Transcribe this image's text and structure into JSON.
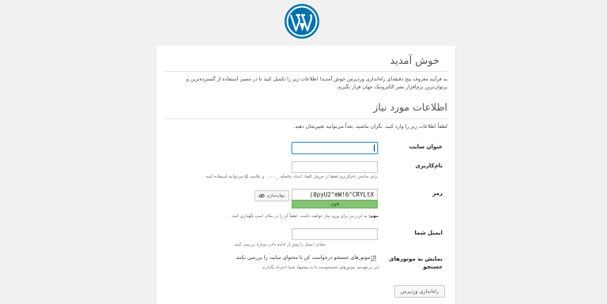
{
  "brand": {
    "logo_icon": "wordpress-logo-icon",
    "logo_color": "#0073aa"
  },
  "welcome": {
    "title": "خوش آمدید",
    "text": "به فرآیند معروف پنج دقیقه‌ای راه‌اندازی وردپرس خوش آمدید! اطلاعات زیر را تکمیل کنید تا در مسیر استفاده از گسترده‌ترین و پرتوان‌ترین نرم‌افزار نشر الکترونیک جهان قرار بگیرید."
  },
  "required_info": {
    "title": "اطلاعات مورد نیاز",
    "text": "لطفاً اطلاعات زیر را وارد کنید. نگران نباشید، بعداً می‌توانید تغییرشان دهید."
  },
  "fields": {
    "site_title": {
      "label": "عنوان سایت",
      "value": ""
    },
    "username": {
      "label": "نام‌کاربری",
      "value": "",
      "hint": "برای ساختن نام‌کاربری فقط از حروف الفبا، اعداد، فاصله، _ ، - ، . و علامت @ می‌توانید استفاده کنید."
    },
    "password": {
      "label": "رمز",
      "value": "(0pyU2^mW!6^CRYLtX",
      "hide_button": "پنهان‌سازی",
      "strength": "قوی",
      "hint_bold": "مهم:",
      "hint": "به این رمز برای ورود نیاز خواهید داشت. لطفاً آن را در مکان امنی نگهداری کنید."
    },
    "email": {
      "label": "ایمیل شما",
      "value": "",
      "hint": "نشانی ایمیل را پیش از ادامه دادن دوباره بررسی کنید."
    },
    "search_visibility": {
      "label_line1": "نمایش به موتورهای",
      "label_line2": "جستجو",
      "checkbox_label": "از موتورهای جستجو درخواست کن تا محتوای سایت را بررسی نکنند",
      "checked": false,
      "hint": "این برعهده‌ی موتورهای جستجوست تا به پیشنهاد شما احترام بگذارند."
    }
  },
  "submit_label": "راه‌اندازی وردپرس"
}
